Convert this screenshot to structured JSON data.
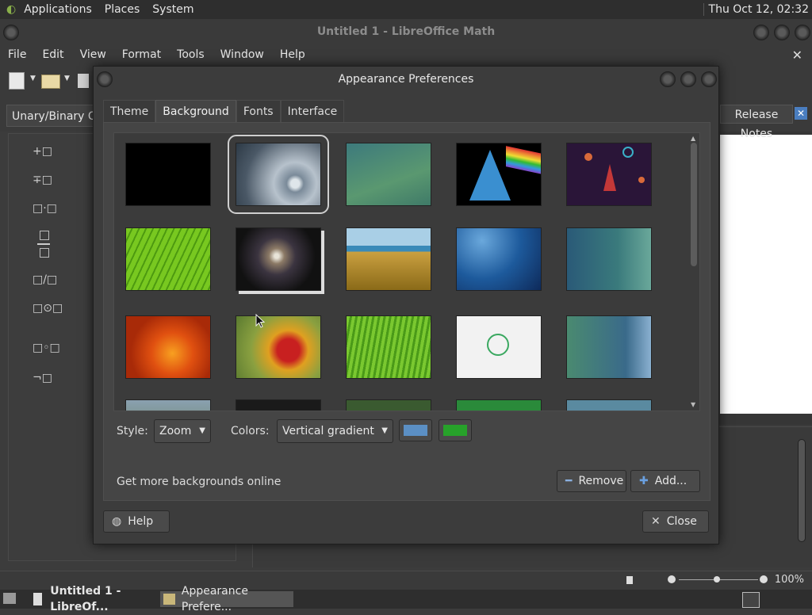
{
  "top_panel": {
    "menus": [
      "Applications",
      "Places",
      "System"
    ],
    "clock": "Thu Oct 12, 02:32"
  },
  "libreoffice": {
    "title": "Untitled 1 - LibreOffice Math",
    "menus": [
      "File",
      "Edit",
      "View",
      "Format",
      "Tools",
      "Window",
      "Help"
    ],
    "close_glyph": "✕",
    "element_category": "Unary/Binary Ope",
    "release_notes": "Release Notes",
    "operators": [
      "+□",
      "∓□",
      "□·□",
      "□/□",
      "□⊙□",
      "□◦□",
      "¬□"
    ],
    "zoom": "100%"
  },
  "dialog": {
    "title": "Appearance Preferences",
    "tabs": [
      "Theme",
      "Background",
      "Fonts",
      "Interface"
    ],
    "active_tab": "Background",
    "style_label": "Style:",
    "style_value": "Zoom",
    "colors_label": "Colors:",
    "colors_value": "Vertical gradient",
    "primary_color": "#5b8fc4",
    "secondary_color": "#27a22a",
    "online_link": "Get more backgrounds online",
    "remove_label": "Remove",
    "add_label": "Add...",
    "help_label": "Help",
    "close_label": "Close"
  },
  "taskbar": {
    "tasks": [
      "Untitled 1 - LibreOf...",
      "Appearance Prefere..."
    ]
  }
}
